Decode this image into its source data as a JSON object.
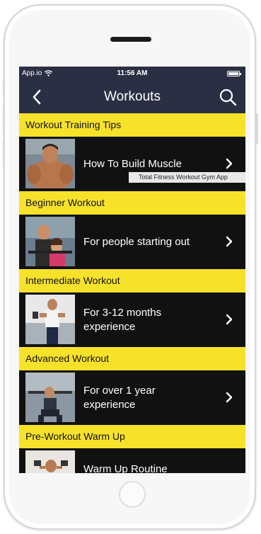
{
  "status_bar": {
    "carrier": "App.io",
    "time": "11:56 AM",
    "wifi_icon": "wifi-icon",
    "battery_icon": "battery-icon"
  },
  "nav": {
    "title": "Workouts",
    "back_icon": "chevron-left-icon",
    "search_icon": "search-icon"
  },
  "sections": [
    {
      "header": "Workout Training Tips",
      "item": {
        "title": "How To Build Muscle",
        "ticker": "Total Fitness Workout Gym App"
      }
    },
    {
      "header": "Beginner Workout",
      "item": {
        "title": "For people starting out"
      }
    },
    {
      "header": "Intermediate Workout",
      "item": {
        "title": "For 3-12 months\nexperience"
      }
    },
    {
      "header": "Advanced Workout",
      "item": {
        "title": "For over 1 year\nexperience"
      }
    },
    {
      "header": "Pre-Workout Warm Up",
      "item": {
        "title": "Warm Up Routine"
      }
    }
  ],
  "colors": {
    "nav_bg": "#2b2f43",
    "section_bg": "#f7e22a",
    "list_bg": "#111111",
    "text_light": "#ffffff"
  }
}
